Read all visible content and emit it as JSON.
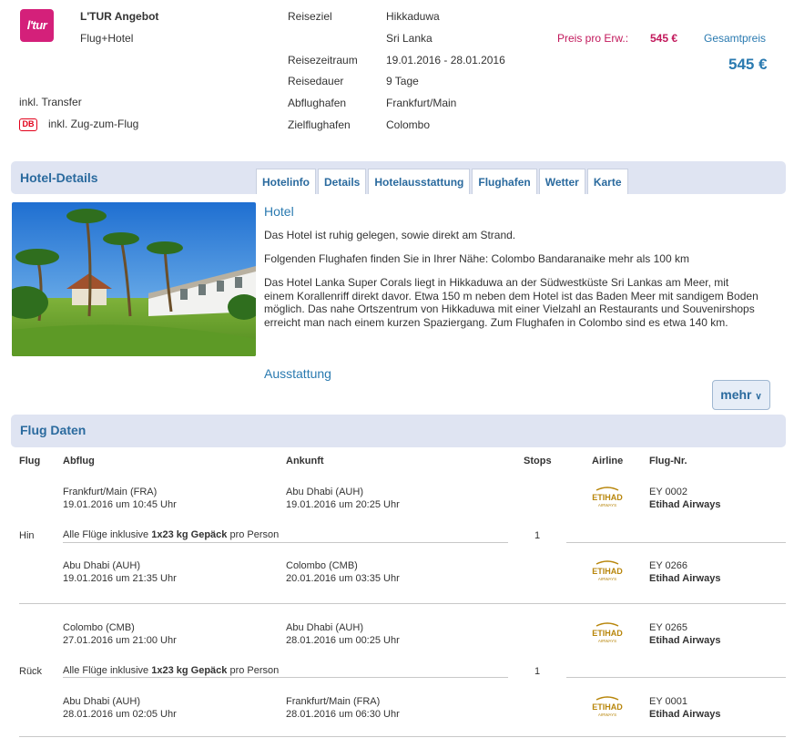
{
  "header": {
    "logo_text": "l'tur",
    "brand": "L'TUR Angebot",
    "type": "Flug+Hotel",
    "details": [
      {
        "label": "Reiseziel",
        "value": "Hikkaduwa"
      },
      {
        "label": "",
        "value": "Sri Lanka"
      },
      {
        "label": "Reisezeitraum",
        "value": "19.01.2016 - 28.01.2016"
      },
      {
        "label": "Reisedauer",
        "value": "9 Tage"
      },
      {
        "label": "Abflughafen",
        "value": "Frankfurt/Main"
      },
      {
        "label": "Zielflughafen",
        "value": "Colombo"
      }
    ],
    "price_per_adult_label": "Preis pro Erw.:",
    "price_per_adult": "545 €",
    "total_label": "Gesamtpreis",
    "total": "545 €",
    "transfer": "inkl. Transfer",
    "db_badge": "DB",
    "train": "inkl. Zug-zum-Flug"
  },
  "hotel": {
    "section_title": "Hotel-Details",
    "tabs": [
      "Hotelinfo",
      "Details",
      "Hotelausstattung",
      "Flughafen",
      "Wetter",
      "Karte"
    ],
    "heading": "Hotel",
    "p1": "Das Hotel ist ruhig gelegen, sowie direkt am Strand.",
    "p2": "Folgenden Flughafen finden Sie in Ihrer Nähe: Colombo Bandaranaike mehr als 100 km",
    "p3": "Das Hotel Lanka Super Corals liegt in Hikkaduwa an der Südwestküste Sri Lankas am Meer, mit einem Korallenriff direkt davor. Etwa 150 m neben dem Hotel ist das Baden Meer mit sandigem Boden möglich. Das nahe Ortszentrum von Hikkaduwa mit einer Vielzahl an Restaurants und Souvenirshops erreicht man nach einem kurzen Spaziergang. Zum Flughafen in Colombo sind es etwa 140 km.",
    "ausstattung": "Ausstattung",
    "mehr": "mehr"
  },
  "flights": {
    "section_title": "Flug Daten",
    "columns": [
      "Flug",
      "Abflug",
      "Ankunft",
      "Stops",
      "Airline",
      "Flug-Nr."
    ],
    "baggage_pre": "Alle Flüge inklusive ",
    "baggage_bold": "1x23 kg Gepäck",
    "baggage_post": " pro Person",
    "airline_logo": "ETIHAD",
    "airline_logo_sub": "AIRWAYS",
    "groups": [
      {
        "label": "Hin",
        "stops": "1",
        "legs": [
          {
            "dep_place": "Frankfurt/Main (FRA)",
            "dep_time": "19.01.2016 um 10:45 Uhr",
            "arr_place": "Abu Dhabi (AUH)",
            "arr_time": "19.01.2016 um 20:25 Uhr",
            "flight_no": "EY 0002",
            "airline": "Etihad Airways"
          },
          {
            "dep_place": "Abu Dhabi (AUH)",
            "dep_time": "19.01.2016 um 21:35 Uhr",
            "arr_place": "Colombo (CMB)",
            "arr_time": "20.01.2016 um 03:35 Uhr",
            "flight_no": "EY 0266",
            "airline": "Etihad Airways"
          }
        ]
      },
      {
        "label": "Rück",
        "stops": "1",
        "legs": [
          {
            "dep_place": "Colombo (CMB)",
            "dep_time": "27.01.2016 um 21:00 Uhr",
            "arr_place": "Abu Dhabi (AUH)",
            "arr_time": "28.01.2016 um 00:25 Uhr",
            "flight_no": "EY 0265",
            "airline": "Etihad Airways"
          },
          {
            "dep_place": "Abu Dhabi (AUH)",
            "dep_time": "28.01.2016 um 02:05 Uhr",
            "arr_place": "Frankfurt/Main (FRA)",
            "arr_time": "28.01.2016 um 06:30 Uhr",
            "flight_no": "EY 0001",
            "airline": "Etihad Airways"
          }
        ]
      }
    ]
  },
  "colors": {
    "accent": "#2a7ab0",
    "price": "#c2185b",
    "bar": "#dfe4f2",
    "logo": "#d4207a"
  }
}
